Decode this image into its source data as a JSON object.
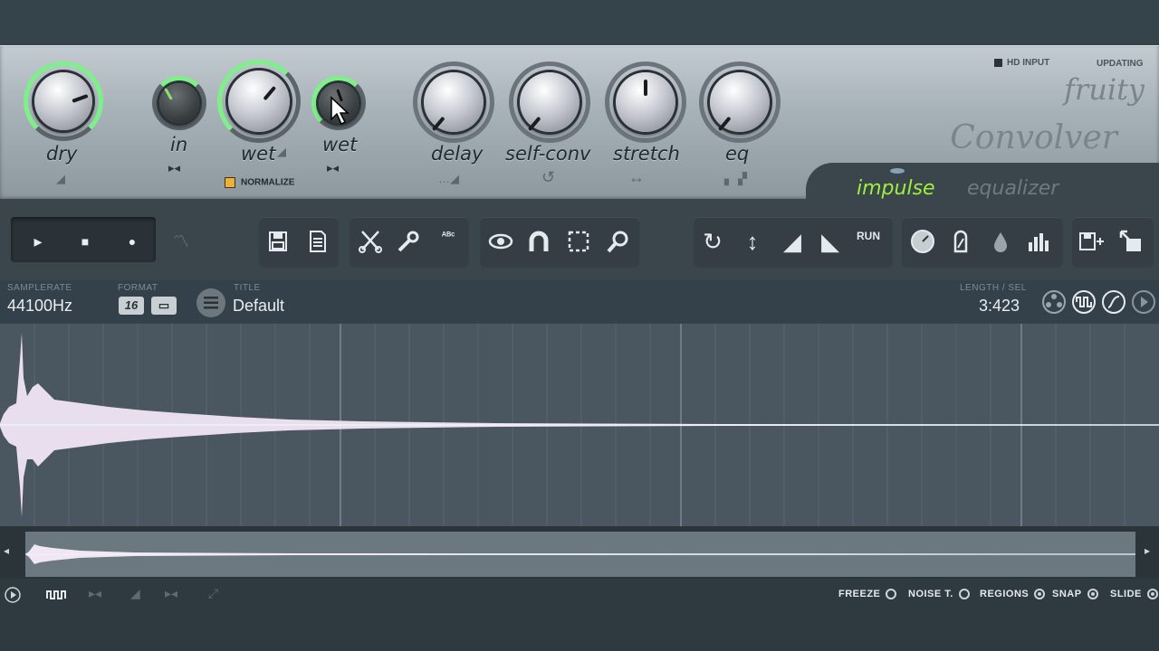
{
  "knobs": [
    {
      "label": "dry",
      "sub": "◢"
    },
    {
      "label": "in",
      "sub": "▸◂"
    },
    {
      "label": "wet",
      "sub": ""
    },
    {
      "label": "wet",
      "sub": "▸◂"
    },
    {
      "label": "delay",
      "sub": "…◢"
    },
    {
      "label": "self-conv",
      "sub": "↺"
    },
    {
      "label": "stretch",
      "sub": "↔"
    },
    {
      "label": "eq",
      "sub": "▖▗▘"
    }
  ],
  "normalize_label": "NORMALIZE",
  "hd_input_label": "HD INPUT",
  "updating_label": "UPDATING",
  "brand": {
    "line1": "fruity",
    "line2": "Convolver"
  },
  "tabs": {
    "impulse": "impulse",
    "equalizer": "equalizer"
  },
  "colors": {
    "accent_green": "#7ef08a",
    "tab_active": "#9df03c",
    "tab_inactive": "#6e7a80"
  },
  "toolbar_icons": {
    "play": "▸",
    "stop": "■",
    "record": "●",
    "scope": "〽",
    "save": "save-icon",
    "new": "document-icon",
    "cut": "scissors-icon",
    "tools": "wrench-icon",
    "abc": "ᴬᴮᶜ",
    "view": "eye-icon",
    "magnet": "magnet-icon",
    "select": "selection-icon",
    "zoom": "zoom-icon",
    "reload": "↻",
    "normalize_v": "↕",
    "fade_in": "◢",
    "decay": "◣",
    "run": "RUN",
    "gauge": "gauge-icon",
    "stamp": "stamp-icon",
    "drop": "drop-icon",
    "bars": "bars-icon",
    "save_plus": "save-plus-icon",
    "export": "export-icon"
  },
  "info": {
    "samplerate_caption": "SAMPLERATE",
    "samplerate_value": "44100Hz",
    "format_caption": "FORMAT",
    "format_value": "16",
    "title_caption": "TITLE",
    "title_value": "Default",
    "length_caption": "LENGTH / SEL",
    "length_value": "3:423"
  },
  "bottom_options": {
    "freeze": "FREEZE",
    "noise": "NOISE T.",
    "regions": "REGIONS",
    "snap": "SNAP",
    "slide": "SLIDE"
  }
}
